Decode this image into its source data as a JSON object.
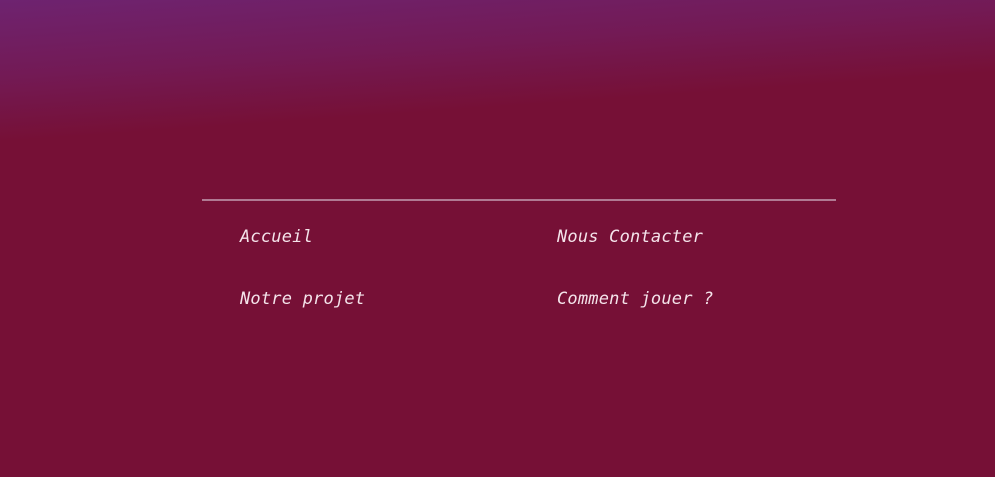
{
  "footer": {
    "links": {
      "accueil": "Accueil",
      "contact": "Nous Contacter",
      "projet": "Notre projet",
      "jouer": "Comment jouer ?"
    }
  },
  "colors": {
    "background_top": "#6e2370",
    "background_main": "#761036",
    "divider": "#b07a93",
    "link_text": "#f4e3ea"
  }
}
